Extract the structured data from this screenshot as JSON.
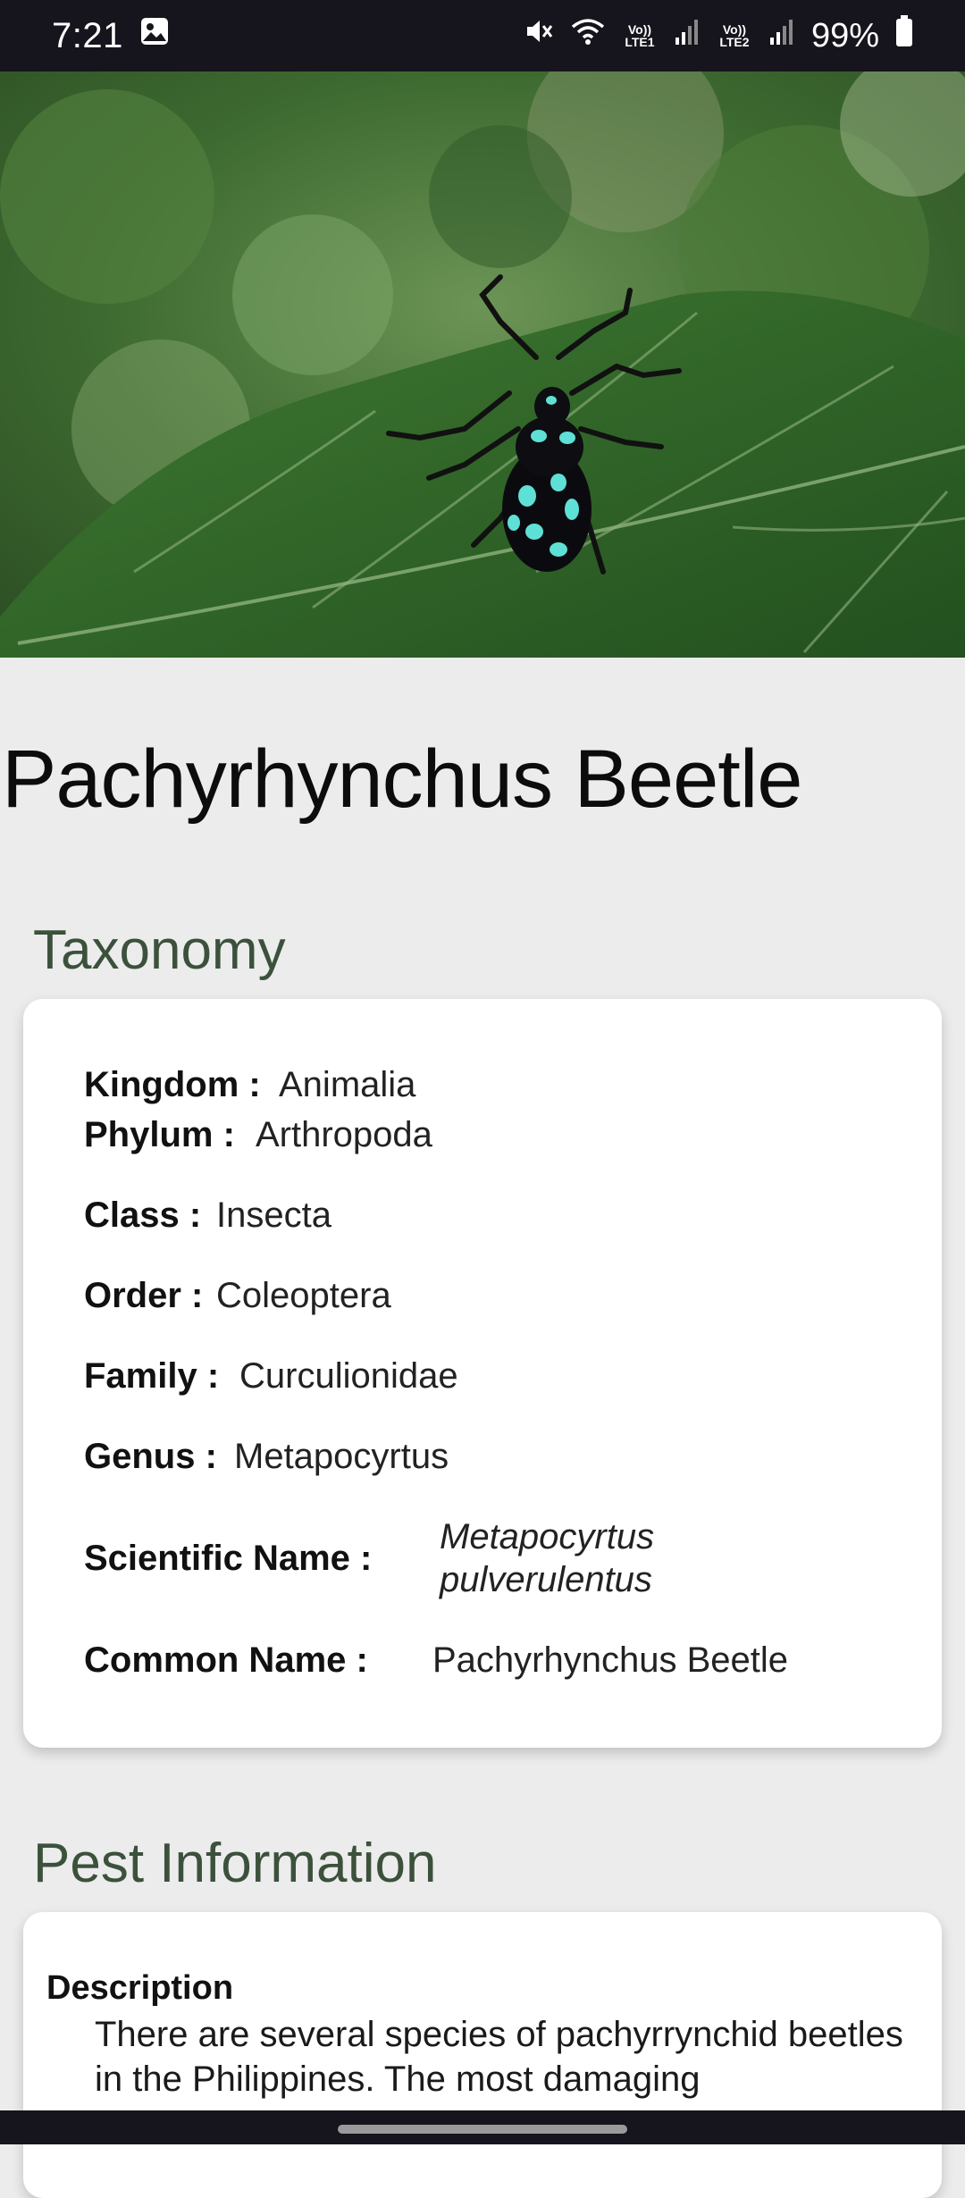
{
  "status_bar": {
    "time": "7:21",
    "battery": "99%",
    "sim1_label": "Vo)) LTE1",
    "sim2_label": "Vo)) LTE2",
    "icons": [
      "gallery-icon",
      "mute-icon",
      "wifi-icon",
      "signal-icon",
      "battery-icon"
    ]
  },
  "hero": {
    "icon": "beetle-photo"
  },
  "page": {
    "title": "Pachyrhynchus Beetle"
  },
  "taxonomy": {
    "heading": "Taxonomy",
    "rows": [
      {
        "label": "Kingdom :",
        "value": "Animalia"
      },
      {
        "label": "Phylum :",
        "value": "Arthropoda"
      },
      {
        "label": "Class :",
        "value": "Insecta"
      },
      {
        "label": "Order :",
        "value": "Coleoptera"
      },
      {
        "label": "Family :",
        "value": "Curculionidae"
      },
      {
        "label": "Genus :",
        "value": "Metapocyrtus"
      },
      {
        "label": "Scientific Name :",
        "value_line1": "Metapocyrtus",
        "value_line2": "pulverulentus"
      },
      {
        "label": "Common Name :",
        "value": "Pachyrhynchus Beetle"
      }
    ]
  },
  "pest_info": {
    "heading": "Pest Information",
    "description_label": "Description",
    "description_text": "There are several species of pachyrrynchid beetles in the Philippines. The most damaging"
  },
  "colors": {
    "status_bar_bg": "#16141c",
    "page_bg": "#ececec",
    "section_heading": "#3c513c",
    "card_bg": "#ffffff"
  }
}
